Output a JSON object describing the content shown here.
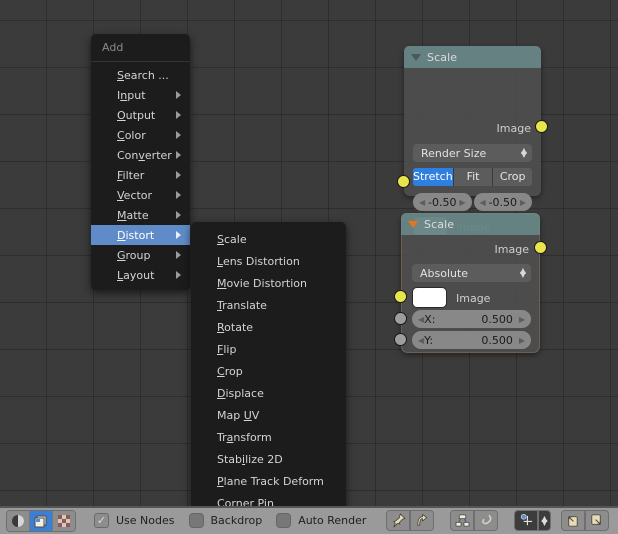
{
  "app": {
    "editor": "node-editor"
  },
  "add_menu": {
    "header": "Add",
    "items": [
      {
        "label": "Search ...",
        "submenu": false
      },
      {
        "label": "Input",
        "submenu": true
      },
      {
        "label": "Output",
        "submenu": true
      },
      {
        "label": "Color",
        "submenu": true
      },
      {
        "label": "Converter",
        "submenu": true
      },
      {
        "label": "Filter",
        "submenu": true
      },
      {
        "label": "Vector",
        "submenu": true
      },
      {
        "label": "Matte",
        "submenu": true
      },
      {
        "label": "Distort",
        "submenu": true,
        "selected": true
      },
      {
        "label": "Group",
        "submenu": true
      },
      {
        "label": "Layout",
        "submenu": true
      }
    ]
  },
  "distort_submenu": {
    "items": [
      {
        "label": "Scale"
      },
      {
        "label": "Lens Distortion"
      },
      {
        "label": "Movie Distortion"
      },
      {
        "label": "Translate"
      },
      {
        "label": "Rotate"
      },
      {
        "label": "Flip"
      },
      {
        "label": "Crop"
      },
      {
        "label": "Displace"
      },
      {
        "label": "Map UV"
      },
      {
        "label": "Transform"
      },
      {
        "label": "Stabilize 2D"
      },
      {
        "label": "Plane Track Deform"
      },
      {
        "label": "Corner Pin"
      }
    ]
  },
  "nodes": [
    {
      "title": "Scale",
      "selected": false,
      "output_label": "Image",
      "input_label": "Image",
      "mode": "Render Size",
      "frame_method": {
        "options": [
          "Stretch",
          "Fit",
          "Crop"
        ],
        "active": "Stretch"
      },
      "offsets": [
        {
          "value": "-0.50"
        },
        {
          "value": "-0.50"
        }
      ]
    },
    {
      "title": "Scale",
      "selected": true,
      "output_label": "Image",
      "input_label": "Image",
      "mode": "Absolute",
      "fields": [
        {
          "label": "X:",
          "value": "0.500"
        },
        {
          "label": "Y:",
          "value": "0.500"
        }
      ]
    }
  ],
  "toolbar": {
    "shading_modes": [
      {
        "name": "material-shading-icon",
        "active": false
      },
      {
        "name": "image-node-icon",
        "active": true
      },
      {
        "name": "texture-checker-icon",
        "active": false
      }
    ],
    "use_nodes": {
      "label": "Use Nodes",
      "checked": true
    },
    "backdrop": {
      "label": "Backdrop",
      "checked": false
    },
    "auto_render": {
      "label": "Auto Render",
      "checked": false
    },
    "buttons": [
      {
        "name": "pin-icon"
      },
      {
        "name": "go-to-parent-icon"
      },
      {
        "name": "node-insert-icon"
      },
      {
        "name": "node-link-icon"
      },
      {
        "name": "snap-magnet-icon"
      },
      {
        "name": "snap-mode-dropdown"
      },
      {
        "name": "copy-to-icon"
      },
      {
        "name": "paste-from-icon"
      }
    ]
  },
  "colors": {
    "accent_selected": "#ed9e5c",
    "menu_highlight": "#5f8cc8",
    "segment_active": "#2f7fe0",
    "socket_image": "#e7e54a",
    "socket_value": "#9d9d9d",
    "node_header": "#6b8e8e",
    "canvas": "#3b3b3b",
    "toolbar": "#9a9a9a"
  }
}
